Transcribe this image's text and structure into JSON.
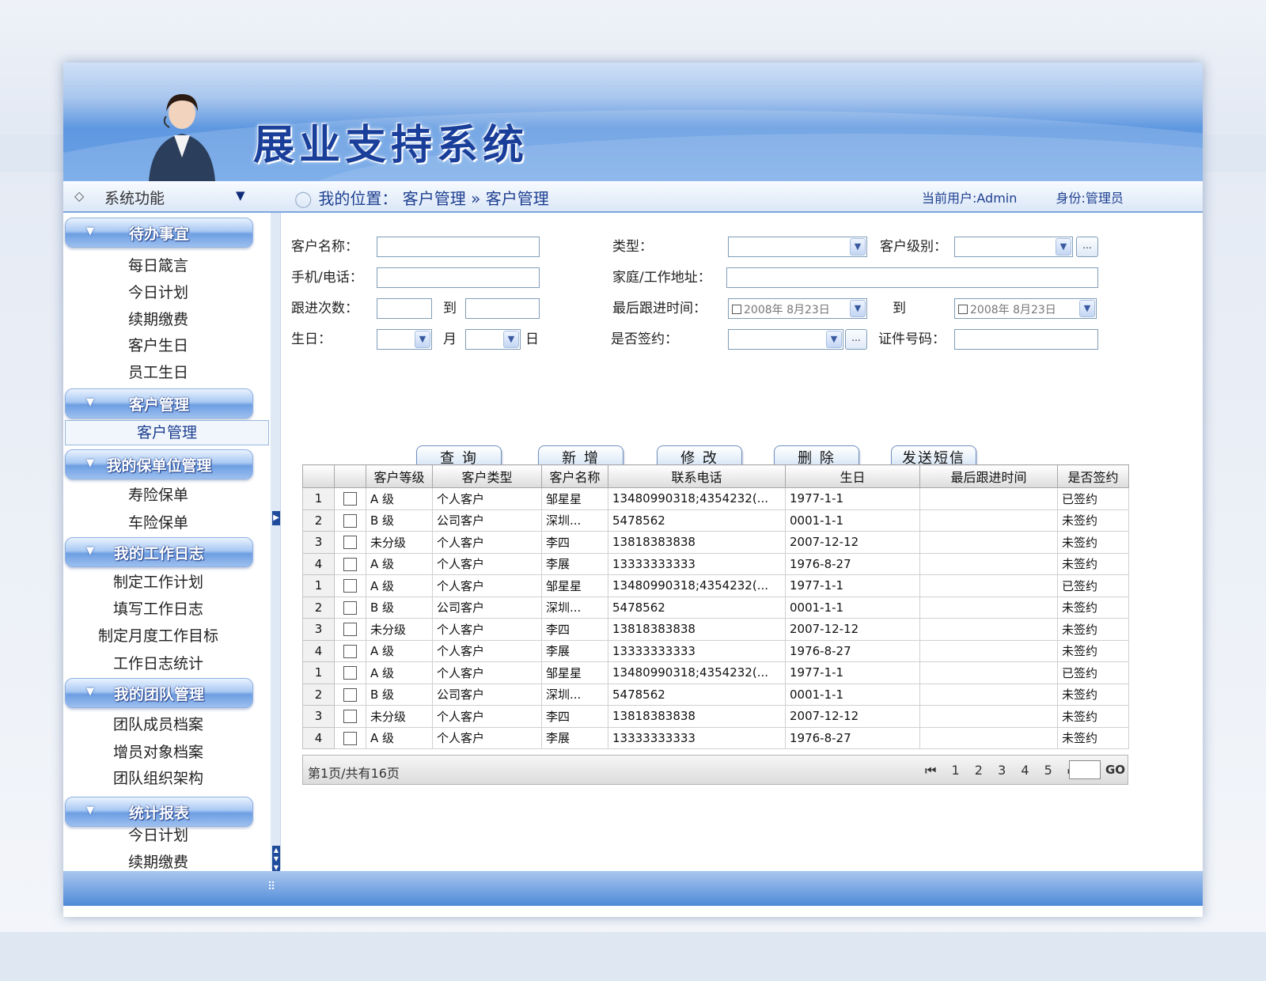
{
  "app": {
    "title": "展业支持系统"
  },
  "titlebar": {
    "sidebar_label": "系统功能",
    "breadcrumb": "我的位置： 客户管理 » 客户管理",
    "current_user": "当前用户:Admin",
    "role": "身份:管理员"
  },
  "sidebar": {
    "groups": [
      {
        "label": "待办事宜",
        "items": [
          "每日箴言",
          "今日计划",
          "续期缴费",
          "客户生日",
          "员工生日"
        ]
      },
      {
        "label": "客户管理",
        "items": [
          "客户管理"
        ]
      },
      {
        "label": "我的保单位管理",
        "items": [
          "寿险保单",
          "车险保单"
        ]
      },
      {
        "label": "我的工作日志",
        "items": [
          "制定工作计划",
          "填写工作日志",
          "制定月度工作目标",
          "工作日志统计"
        ]
      },
      {
        "label": "我的团队管理",
        "items": [
          "团队成员档案",
          "增员对象档案",
          "团队组织架构"
        ]
      },
      {
        "label": "统计报表",
        "items": [
          "今日计划",
          "续期缴费"
        ]
      }
    ]
  },
  "form": {
    "customer_name": "客户名称：",
    "type": "类型：",
    "customer_level": "客户级别：",
    "phone": "手机/电话：",
    "address": "家庭/工作地址：",
    "followup_count": "跟进次数：",
    "to": "到",
    "last_followup": "最后跟进时间：",
    "date_from": "2008年 8月23日",
    "date_to": "2008年 8月23日",
    "birthday": "生日：",
    "month": "月",
    "day": "日",
    "signed": "是否签约：",
    "id_number": "证件号码：",
    "dots": "..."
  },
  "buttons": {
    "query": "查 询",
    "add": "新 增",
    "edit": "修 改",
    "delete": "删 除",
    "sms": "发送短信"
  },
  "table": {
    "headers": [
      "",
      "",
      "客户等级",
      "客户类型",
      "客户名称",
      "联系电话",
      "生日",
      "最后跟进时间",
      "是否签约"
    ],
    "rows": [
      [
        "1",
        "A 级",
        "个人客户",
        "邹星星",
        "13480990318;4354232(...",
        "1977-1-1",
        "",
        "已签约"
      ],
      [
        "2",
        "B 级",
        "公司客户",
        "深圳...",
        "5478562",
        "0001-1-1",
        "",
        "未签约"
      ],
      [
        "3",
        "未分级",
        "个人客户",
        "李四",
        "13818383838",
        "2007-12-12",
        "",
        "未签约"
      ],
      [
        "4",
        "A 级",
        "个人客户",
        "李展",
        "13333333333",
        "1976-8-27",
        "",
        "未签约"
      ],
      [
        "1",
        "A 级",
        "个人客户",
        "邹星星",
        "13480990318;4354232(...",
        "1977-1-1",
        "",
        "已签约"
      ],
      [
        "2",
        "B 级",
        "公司客户",
        "深圳...",
        "5478562",
        "0001-1-1",
        "",
        "未签约"
      ],
      [
        "3",
        "未分级",
        "个人客户",
        "李四",
        "13818383838",
        "2007-12-12",
        "",
        "未签约"
      ],
      [
        "4",
        "A 级",
        "个人客户",
        "李展",
        "13333333333",
        "1976-8-27",
        "",
        "未签约"
      ],
      [
        "1",
        "A 级",
        "个人客户",
        "邹星星",
        "13480990318;4354232(...",
        "1977-1-1",
        "",
        "已签约"
      ],
      [
        "2",
        "B 级",
        "公司客户",
        "深圳...",
        "5478562",
        "0001-1-1",
        "",
        "未签约"
      ],
      [
        "3",
        "未分级",
        "个人客户",
        "李四",
        "13818383838",
        "2007-12-12",
        "",
        "未签约"
      ],
      [
        "4",
        "A 级",
        "个人客户",
        "李展",
        "13333333333",
        "1976-8-27",
        "",
        "未签约"
      ]
    ]
  },
  "pager": {
    "info": "第1页/共有16页",
    "first_icon": "first-page-icon",
    "pages": [
      "1",
      "2",
      "3",
      "4",
      "5"
    ],
    "last_icon": "last-page-icon",
    "go": "GO"
  },
  "colors": {
    "brand": "#1a3f9a",
    "header_blue": "#5f98e0",
    "accent_border": "#7ea6dc"
  }
}
